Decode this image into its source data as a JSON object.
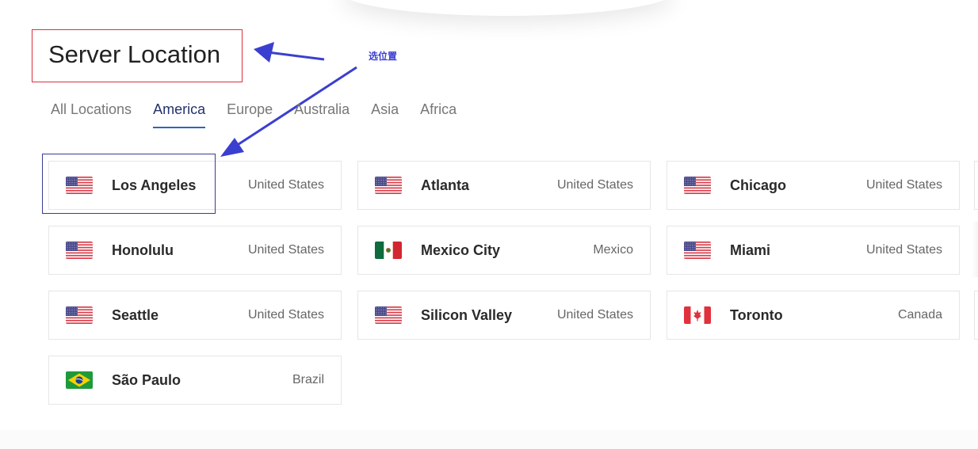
{
  "header": {
    "title": "Server Location"
  },
  "annotation": {
    "label": "选位置",
    "color": "#3a3fd0",
    "box_color": "#d9333f"
  },
  "tabs": [
    {
      "label": "All Locations",
      "active": false
    },
    {
      "label": "America",
      "active": true
    },
    {
      "label": "Europe",
      "active": false
    },
    {
      "label": "Australia",
      "active": false
    },
    {
      "label": "Asia",
      "active": false
    },
    {
      "label": "Africa",
      "active": false
    }
  ],
  "accent": "#2a67b8",
  "locations": [
    {
      "city": "Los Angeles",
      "country": "United States",
      "flag": "us-flag-icon"
    },
    {
      "city": "Atlanta",
      "country": "United States",
      "flag": "us-flag-icon"
    },
    {
      "city": "Chicago",
      "country": "United States",
      "flag": "us-flag-icon"
    },
    {
      "city": "Honolulu",
      "country": "United States",
      "flag": "us-flag-icon"
    },
    {
      "city": "Mexico City",
      "country": "Mexico",
      "flag": "mexico-flag-icon"
    },
    {
      "city": "Miami",
      "country": "United States",
      "flag": "us-flag-icon"
    },
    {
      "city": "Seattle",
      "country": "United States",
      "flag": "us-flag-icon"
    },
    {
      "city": "Silicon Valley",
      "country": "United States",
      "flag": "us-flag-icon"
    },
    {
      "city": "Toronto",
      "country": "Canada",
      "flag": "canada-flag-icon"
    },
    {
      "city": "São Paulo",
      "country": "Brazil",
      "flag": "brazil-flag-icon"
    }
  ]
}
